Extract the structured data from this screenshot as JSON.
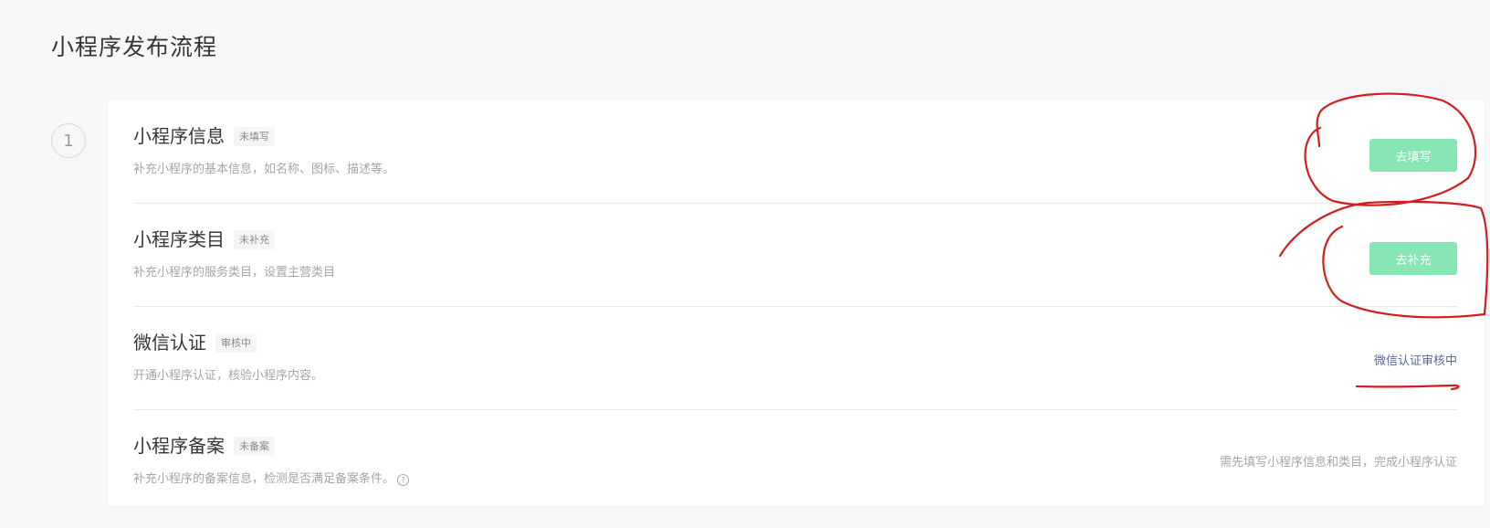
{
  "page": {
    "title": "小程序发布流程"
  },
  "step": {
    "number": "1"
  },
  "rows": [
    {
      "title": "小程序信息",
      "badge": "未填写",
      "desc": "补充小程序的基本信息，如名称、图标、描述等。",
      "action_label": "去填写"
    },
    {
      "title": "小程序类目",
      "badge": "未补充",
      "desc": "补充小程序的服务类目，设置主营类目",
      "action_label": "去补充"
    },
    {
      "title": "微信认证",
      "badge": "审核中",
      "desc": "开通小程序认证，核验小程序内容。",
      "status_link": "微信认证审核中"
    },
    {
      "title": "小程序备案",
      "badge": "未备案",
      "desc": "补充小程序的备案信息，检测是否满足备案条件。",
      "status_text": "需先填写小程序信息和类目，完成小程序认证",
      "help_icon": "?"
    }
  ],
  "colors": {
    "button_bg": "#88e5b4",
    "link": "#576b95",
    "annotation": "#d11f1f"
  },
  "icons": {
    "help": "question-circle-icon"
  }
}
